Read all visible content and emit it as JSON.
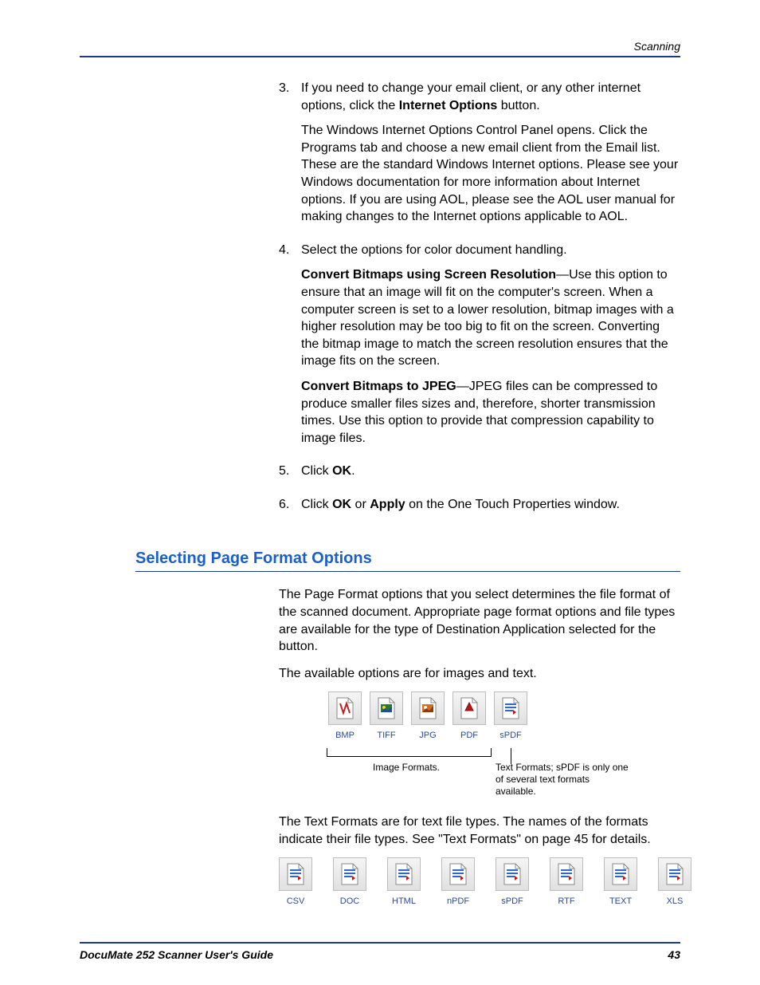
{
  "header": {
    "section": "Scanning"
  },
  "steps": [
    {
      "num": "3.",
      "text_pre": "If you need to change your email client, or any other internet options, click the ",
      "bold1": "Internet Options",
      "text_post": " button.",
      "para2": "The Windows Internet Options Control Panel opens. Click the Programs tab and choose a new email client from the Email list. These are the standard Windows Internet options. Please see your Windows documentation for more information about Internet options. If you are using AOL, please see the AOL user manual for making changes to the Internet options applicable to AOL."
    },
    {
      "num": "4.",
      "text": "Select the options for color document handling.",
      "sub1_bold": "Convert Bitmaps using Screen Resolution",
      "sub1_rest": "—Use this option to ensure that an image will fit on the computer's screen. When a computer screen is set to a lower resolution, bitmap images with a higher resolution may be too big to fit on the screen. Converting the bitmap image to match the screen resolution ensures that the image fits on the screen.",
      "sub2_bold": "Convert Bitmaps to JPEG",
      "sub2_rest": "—JPEG files can be compressed to produce smaller files sizes and, therefore, shorter transmission times. Use this option to provide that compression capability to image files."
    },
    {
      "num": "5.",
      "pre": "Click ",
      "bold": "OK",
      "post": "."
    },
    {
      "num": "6.",
      "pre": "Click ",
      "bold1": "OK",
      "mid": " or ",
      "bold2": "Apply",
      "post": " on the One Touch Properties window."
    }
  ],
  "heading": "Selecting Page Format Options",
  "intro1": "The Page Format options that you select determines the file format of the scanned document. Appropriate page format options and file types are available for the type of Destination Application selected for the button.",
  "intro2": "The available options are for images and text.",
  "image_formats": [
    {
      "label": "BMP",
      "kind": "bmp"
    },
    {
      "label": "TIFF",
      "kind": "tiff"
    },
    {
      "label": "JPG",
      "kind": "jpg"
    },
    {
      "label": "PDF",
      "kind": "pdf"
    },
    {
      "label": "sPDF",
      "kind": "spdf"
    }
  ],
  "caption_image": "Image Formats.",
  "caption_text": "Text Formats; sPDF is only one of several text formats available.",
  "intro3": "The Text Formats are for text file types. The names of the formats indicate their file types. See \"Text Formats\" on page 45 for details.",
  "text_formats": [
    {
      "label": "CSV"
    },
    {
      "label": "DOC"
    },
    {
      "label": "HTML"
    },
    {
      "label": "nPDF"
    },
    {
      "label": "sPDF"
    },
    {
      "label": "RTF"
    },
    {
      "label": "TEXT"
    },
    {
      "label": "XLS"
    }
  ],
  "footer": {
    "title": "DocuMate 252 Scanner User's Guide",
    "page": "43"
  }
}
